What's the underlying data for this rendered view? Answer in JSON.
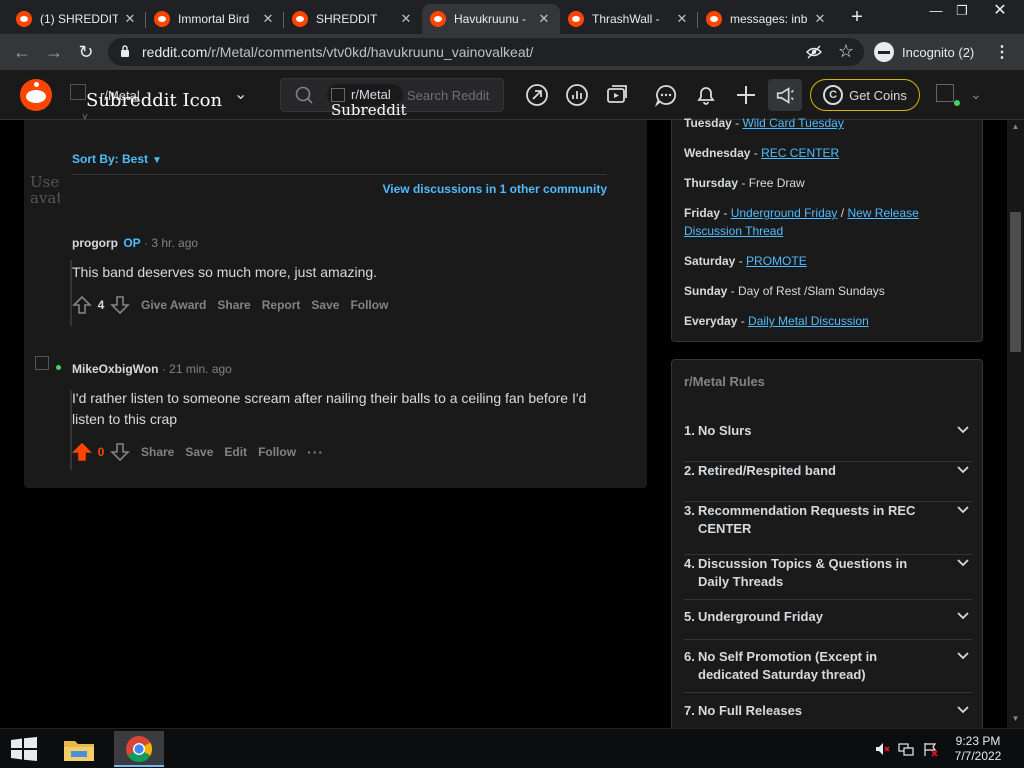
{
  "browser": {
    "tabs": [
      {
        "title": "(1) SHREDDIT",
        "active": false
      },
      {
        "title": "Immortal Bird",
        "active": false
      },
      {
        "title": "SHREDDIT",
        "active": false
      },
      {
        "title": "Havukruunu -",
        "active": true
      },
      {
        "title": "ThrashWall -",
        "active": false
      },
      {
        "title": "messages: inb",
        "active": false
      }
    ],
    "new_tab_label": "+",
    "url_host": "reddit.com",
    "url_path": "/r/Metal/comments/vtv0kd/havukruunu_vainovalkeat/",
    "profile_label": "Incognito (2)"
  },
  "reddit_header": {
    "community_label": "r/Metal",
    "community_icon_alt": "Subreddit Icon",
    "search_pill_label": "r/Metal",
    "search_pill_alt": "Subreddit Icon",
    "search_placeholder": "Search Reddit",
    "coins_label": "Get Coins"
  },
  "comments_panel": {
    "sort_label": "Sort By: Best",
    "other_community_link": "View discussions in 1 other community",
    "avatar_alt": "User avatar",
    "comments": [
      {
        "author": "progorp",
        "op_badge": "OP",
        "time": "3 hr. ago",
        "body": "This band deserves so much more, just amazing.",
        "score": "4",
        "actions": [
          "Give Award",
          "Share",
          "Report",
          "Save",
          "Follow"
        ]
      },
      {
        "author": "MikeOxbigWon",
        "time": "21 min. ago",
        "body": "I'd rather listen to someone scream after nailing their balls to a ceiling fan before I'd listen to this crap",
        "score": "0",
        "actions": [
          "Share",
          "Save",
          "Edit",
          "Follow"
        ],
        "more_label": "···"
      }
    ]
  },
  "sidebar": {
    "schedule": [
      {
        "day": "Tuesday",
        "sep": " - ",
        "link": "Wild Card Tuesday"
      },
      {
        "day": "Wednesday",
        "sep": " - ",
        "link": "REC CENTER"
      },
      {
        "day": "Thursday",
        "sep": " - ",
        "text": "Free Draw"
      },
      {
        "day": "Friday",
        "sep": " - ",
        "link": "Underground Friday",
        "joiner": " / ",
        "link2": "New Release Discussion Thread"
      },
      {
        "day": "Saturday",
        "sep": " - ",
        "link": "PROMOTE"
      },
      {
        "day": "Sunday",
        "sep": " - ",
        "text": "Day of Rest /Slam Sundays"
      },
      {
        "day": "Everyday",
        "sep": " - ",
        "link": "Daily Metal Discussion"
      }
    ],
    "rules_title": "r/Metal Rules",
    "rules": [
      {
        "num": "1.",
        "text": "No Slurs"
      },
      {
        "num": "2.",
        "text": "Retired/Respited band"
      },
      {
        "num": "3.",
        "text": "Recommendation Requests in REC CENTER"
      },
      {
        "num": "4.",
        "text": "Discussion Topics & Questions in Daily Threads"
      },
      {
        "num": "5.",
        "text": "Underground Friday"
      },
      {
        "num": "6.",
        "text": "No Self Promotion (Except in dedicated Saturday thread)"
      },
      {
        "num": "7.",
        "text": "No Full Releases"
      }
    ]
  },
  "taskbar": {
    "time": "9:23 PM",
    "date": "7/7/2022"
  },
  "colors": {
    "accent_link": "#4fbcff",
    "upvote_orange": "#ff4500",
    "coin_border": "#d7b500"
  }
}
